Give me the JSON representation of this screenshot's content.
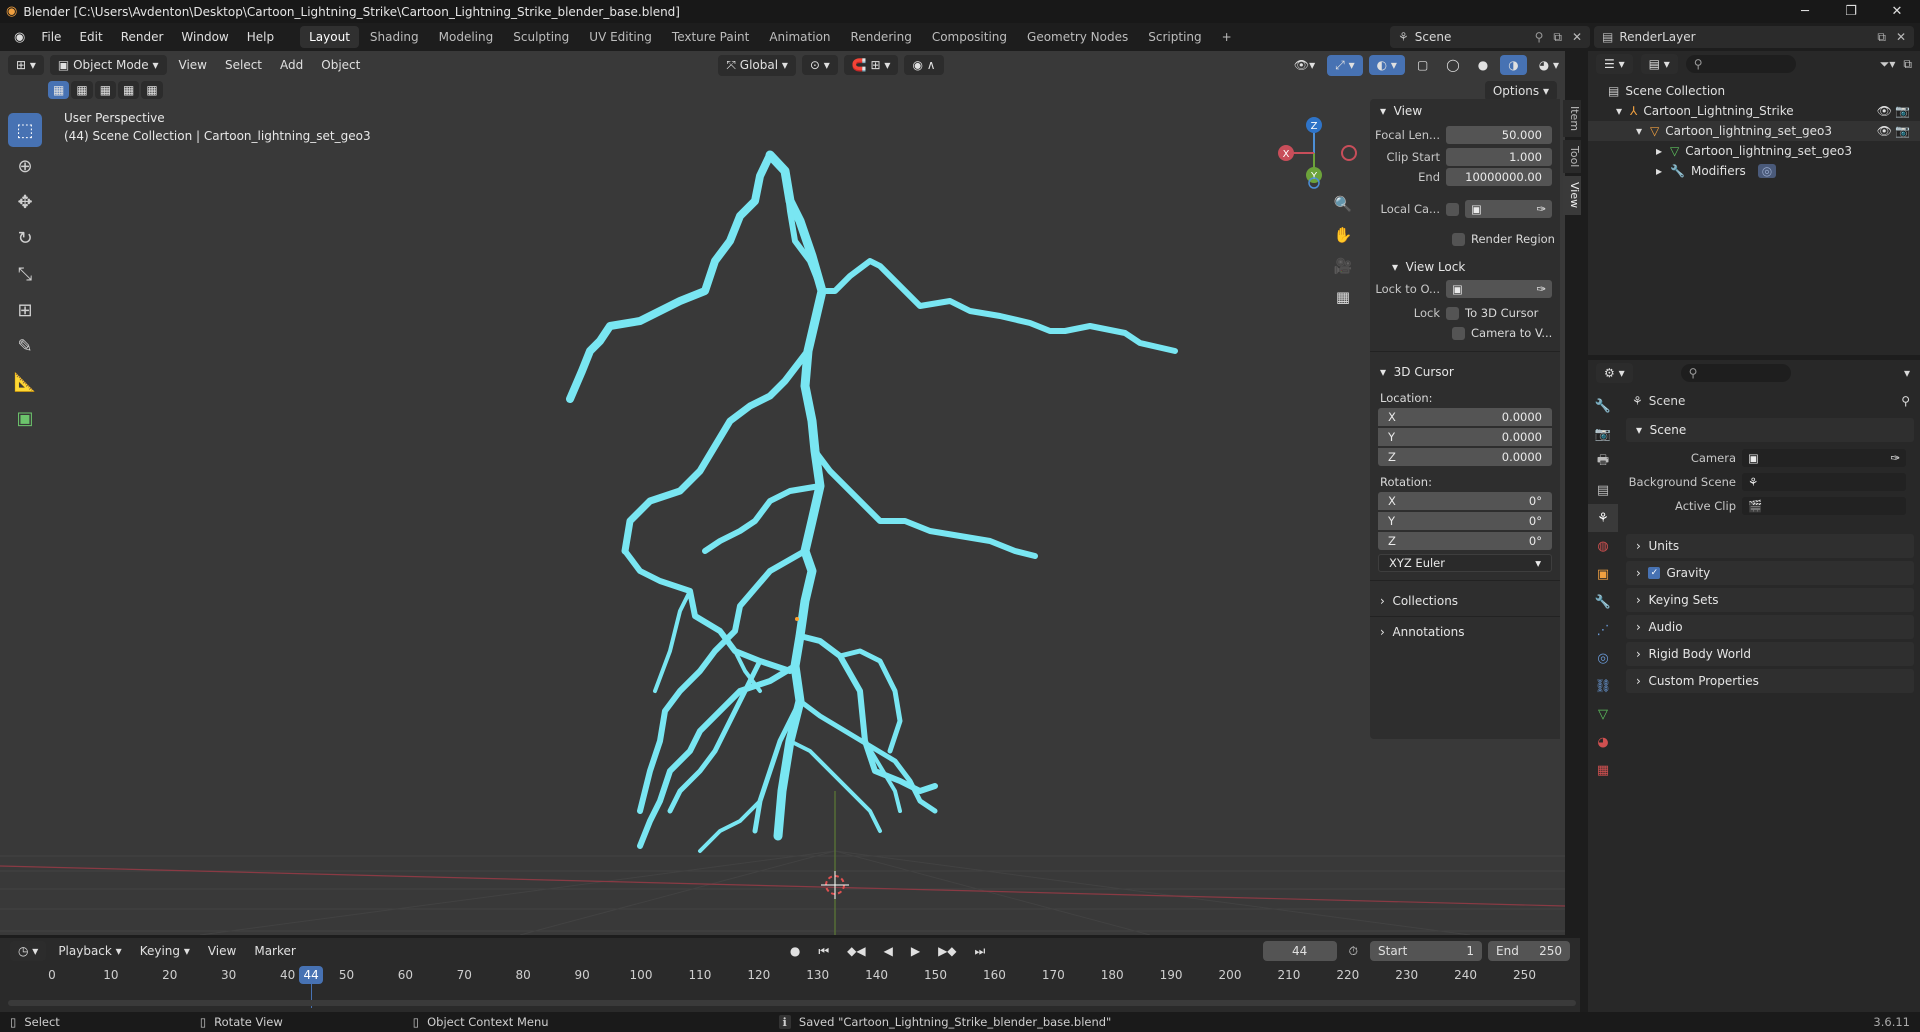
{
  "titlebar": {
    "title": "Blender [C:\\Users\\Avdenton\\Desktop\\Cartoon_Lightning_Strike\\Cartoon_Lightning_Strike_blender_base.blend]"
  },
  "menu": {
    "file": "File",
    "edit": "Edit",
    "render": "Render",
    "window": "Window",
    "help": "Help"
  },
  "workspaces": [
    "Layout",
    "Shading",
    "Modeling",
    "Sculpting",
    "UV Editing",
    "Texture Paint",
    "Animation",
    "Rendering",
    "Compositing",
    "Geometry Nodes",
    "Scripting",
    "+"
  ],
  "scene": {
    "name": "Scene",
    "render_layer": "RenderLayer"
  },
  "viewport_header": {
    "mode": "Object Mode",
    "view": "View",
    "select": "Select",
    "add": "Add",
    "object": "Object",
    "orientation": "Global",
    "options": "Options"
  },
  "viewport": {
    "perspective": "User Perspective",
    "collection_info": "(44) Scene Collection | Cartoon_lightning_set_geo3",
    "lightning_color": "#79e6f2"
  },
  "gizmo": {
    "z": "Z",
    "y": "Y",
    "x": "X"
  },
  "npanel": {
    "tabs": [
      "Item",
      "Tool",
      "View"
    ],
    "view_title": "View",
    "focal_label": "Focal Len...",
    "focal_value": "50.000",
    "clip_start_label": "Clip Start",
    "clip_start_value": "1.000",
    "clip_end_label": "End",
    "clip_end_value": "10000000.00",
    "local_cam_label": "Local Ca...",
    "render_region": "Render Region",
    "view_lock_title": "View Lock",
    "lock_to_label": "Lock to O...",
    "lock_label": "Lock",
    "to_cursor": "To 3D Cursor",
    "camera_to_view": "Camera to V...",
    "cursor_title": "3D Cursor",
    "location_label": "Location:",
    "loc": [
      {
        "axis": "X",
        "value": "0.0000"
      },
      {
        "axis": "Y",
        "value": "0.0000"
      },
      {
        "axis": "Z",
        "value": "0.0000"
      }
    ],
    "rotation_label": "Rotation:",
    "rot": [
      {
        "axis": "X",
        "value": "0°"
      },
      {
        "axis": "Y",
        "value": "0°"
      },
      {
        "axis": "Z",
        "value": "0°"
      }
    ],
    "rotation_mode": "XYZ Euler",
    "collections": "Collections",
    "annotations": "Annotations"
  },
  "outliner": {
    "root": "Scene Collection",
    "items": [
      "Cartoon_Lightning_Strike",
      "Cartoon_lightning_set_geo3",
      "Cartoon_lightning_set_geo3",
      "Modifiers"
    ]
  },
  "properties": {
    "header": "Scene",
    "section_scene": "Scene",
    "camera_label": "Camera",
    "background_label": "Background Scene",
    "active_clip_label": "Active Clip",
    "sections": [
      "Units",
      "Gravity",
      "Keying Sets",
      "Audio",
      "Rigid Body World",
      "Custom Properties"
    ]
  },
  "timeline": {
    "playback": "Playback",
    "keying": "Keying",
    "view": "View",
    "marker": "Marker",
    "current_frame": "44",
    "start_label": "Start",
    "start": "1",
    "end_label": "End",
    "end": "250",
    "ticks": [
      "0",
      "10",
      "20",
      "30",
      "40",
      "50",
      "60",
      "70",
      "80",
      "90",
      "100",
      "110",
      "120",
      "130",
      "140",
      "150",
      "160",
      "170",
      "180",
      "190",
      "200",
      "210",
      "220",
      "230",
      "240",
      "250"
    ],
    "playhead": "44"
  },
  "status": {
    "select": "Select",
    "rotate": "Rotate View",
    "context": "Object Context Menu",
    "message": "Saved \"Cartoon_Lightning_Strike_blender_base.blend\"",
    "version": "3.6.11"
  }
}
